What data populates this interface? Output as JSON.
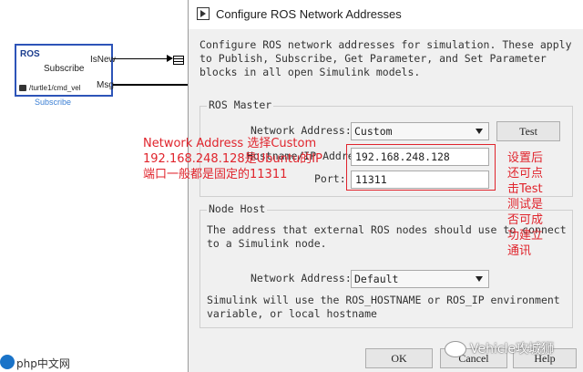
{
  "simulink": {
    "block_title": "ROS",
    "block_center": "Subscribe",
    "port_isnew": "IsNew",
    "port_msg": "Msg",
    "topic": "/turtle1/cmd_vel",
    "block_name": "Subscribe"
  },
  "dialog": {
    "title": "Configure ROS Network Addresses",
    "description": "Configure ROS network addresses for simulation. These apply to Publish, Subscribe, Get Parameter, and Set Parameter blocks in all open Simulink models.",
    "master": {
      "group_label": "ROS Master",
      "network_address_label": "Network Address:",
      "network_address_value": "Custom",
      "test_button": "Test",
      "hostname_label": "Hostname/IP Address:",
      "hostname_value": "192.168.248.128",
      "port_label": "Port:",
      "port_value": "11311"
    },
    "node_host": {
      "group_label": "Node Host",
      "description": "The address that external ROS nodes should use to connect to a Simulink node.",
      "network_address_label": "Network Address:",
      "network_address_value": "Default",
      "note": "Simulink will use the ROS_HOSTNAME or ROS_IP environment variable, or local hostname"
    },
    "buttons": {
      "ok": "OK",
      "cancel": "Cancel",
      "help": "Help"
    }
  },
  "annotations": {
    "left_line1": "Network Address 选择Custom",
    "left_line2": "192.168.248.128是Ubuntu的IP",
    "left_line3": "端口一般都是固定的11311",
    "right_lines": [
      "设置后",
      "还可点",
      "击Test",
      "测试是",
      "否可成",
      "功建立",
      "通讯"
    ],
    "accent_color": "#e0242c"
  },
  "watermarks": {
    "bottom_right": "Vehicle攻城狮",
    "bottom_left": "php中文网"
  }
}
